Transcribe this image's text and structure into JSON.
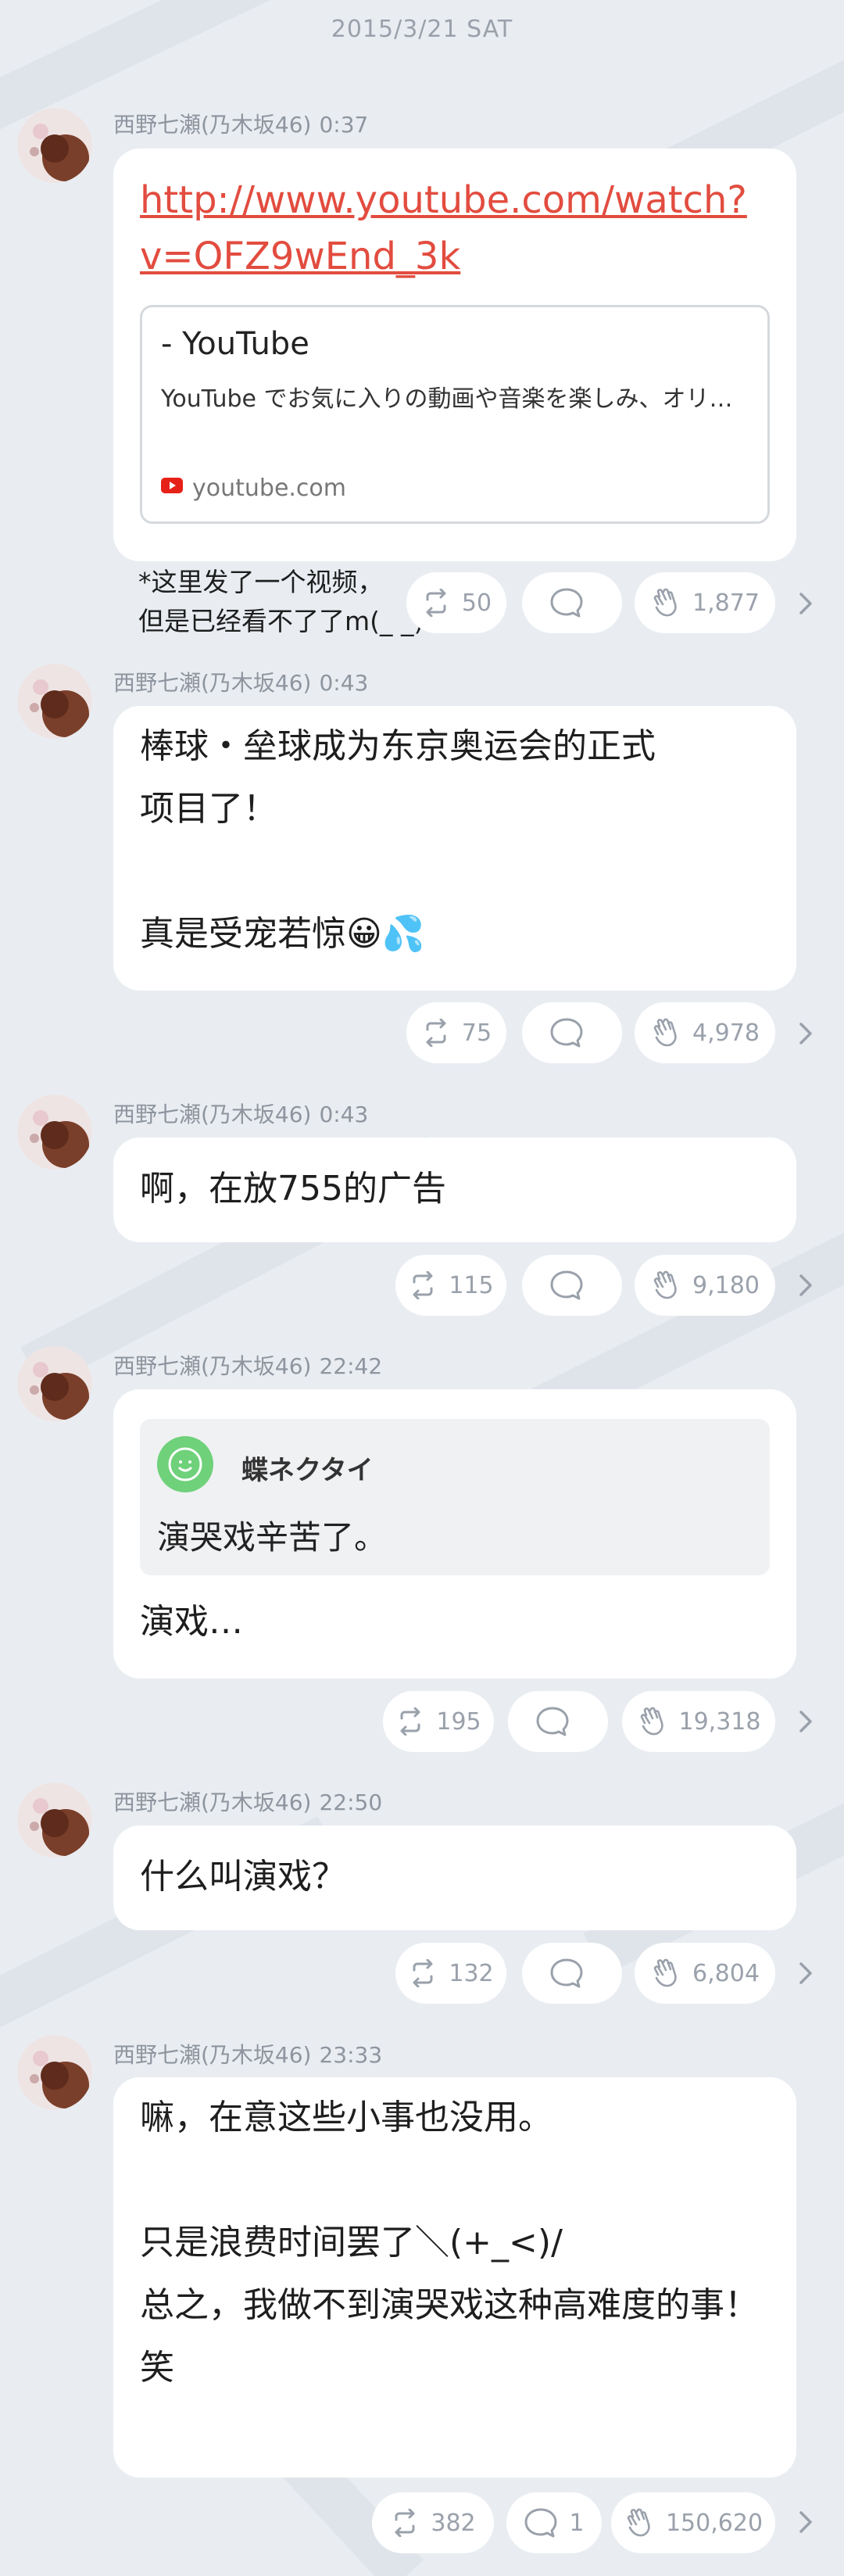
{
  "date_header": "2015/3/21 SAT",
  "posts": [
    {
      "author": "西野七瀬(乃木坂46)",
      "time": "0:37",
      "link_url": "http://www.youtube.com/watch?v=OFZ9wEnd_3k",
      "card_title": " - YouTube",
      "card_desc": "YouTube でお気に入りの動画や音楽を楽しみ、オリ…",
      "card_domain": "youtube.com",
      "caption": "*这里发了一个视频，\n但是已经看不了了m(_ _)m",
      "repost": "50",
      "comment": "",
      "clap": "1,877"
    },
    {
      "author": "西野七瀬(乃木坂46)",
      "time": "0:43",
      "text": "棒球・垒球成为东京奥运会的正式\n项目了！\n\n真是受宠若惊😀💦",
      "repost": "75",
      "comment": "",
      "clap": "4,978"
    },
    {
      "author": "西野七瀬(乃木坂46)",
      "time": "0:43",
      "text": "啊，在放755的广告",
      "repost": "115",
      "comment": "",
      "clap": "9,180"
    },
    {
      "author": "西野七瀬(乃木坂46)",
      "time": "22:42",
      "quote_name": "蝶ネクタイ",
      "quote_text": "演哭戏辛苦了。",
      "text": "演戏…",
      "repost": "195",
      "comment": "",
      "clap": "19,318"
    },
    {
      "author": "西野七瀬(乃木坂46)",
      "time": "22:50",
      "text": "什么叫演戏？",
      "repost": "132",
      "comment": "",
      "clap": "6,804"
    },
    {
      "author": "西野七瀬(乃木坂46)",
      "time": "23:33",
      "text": "嘛，在意这些小事也没用。\n\n只是浪费时间罢了＼(+_<)/\n总之，我做不到演哭戏这种高难度的事！\n笑",
      "repost": "382",
      "comment": "1",
      "clap": "150,620"
    }
  ],
  "icons": {
    "repost": "repost-icon",
    "comment": "comment-icon",
    "clap": "clap-icon",
    "more": "chevron-right-icon",
    "avatar": "avatar"
  },
  "colors": {
    "background": "#e9edf2",
    "bubble": "#ffffff",
    "link": "#e24c3f",
    "meta": "#8e959f",
    "quote_avatar": "#6fd17a"
  }
}
